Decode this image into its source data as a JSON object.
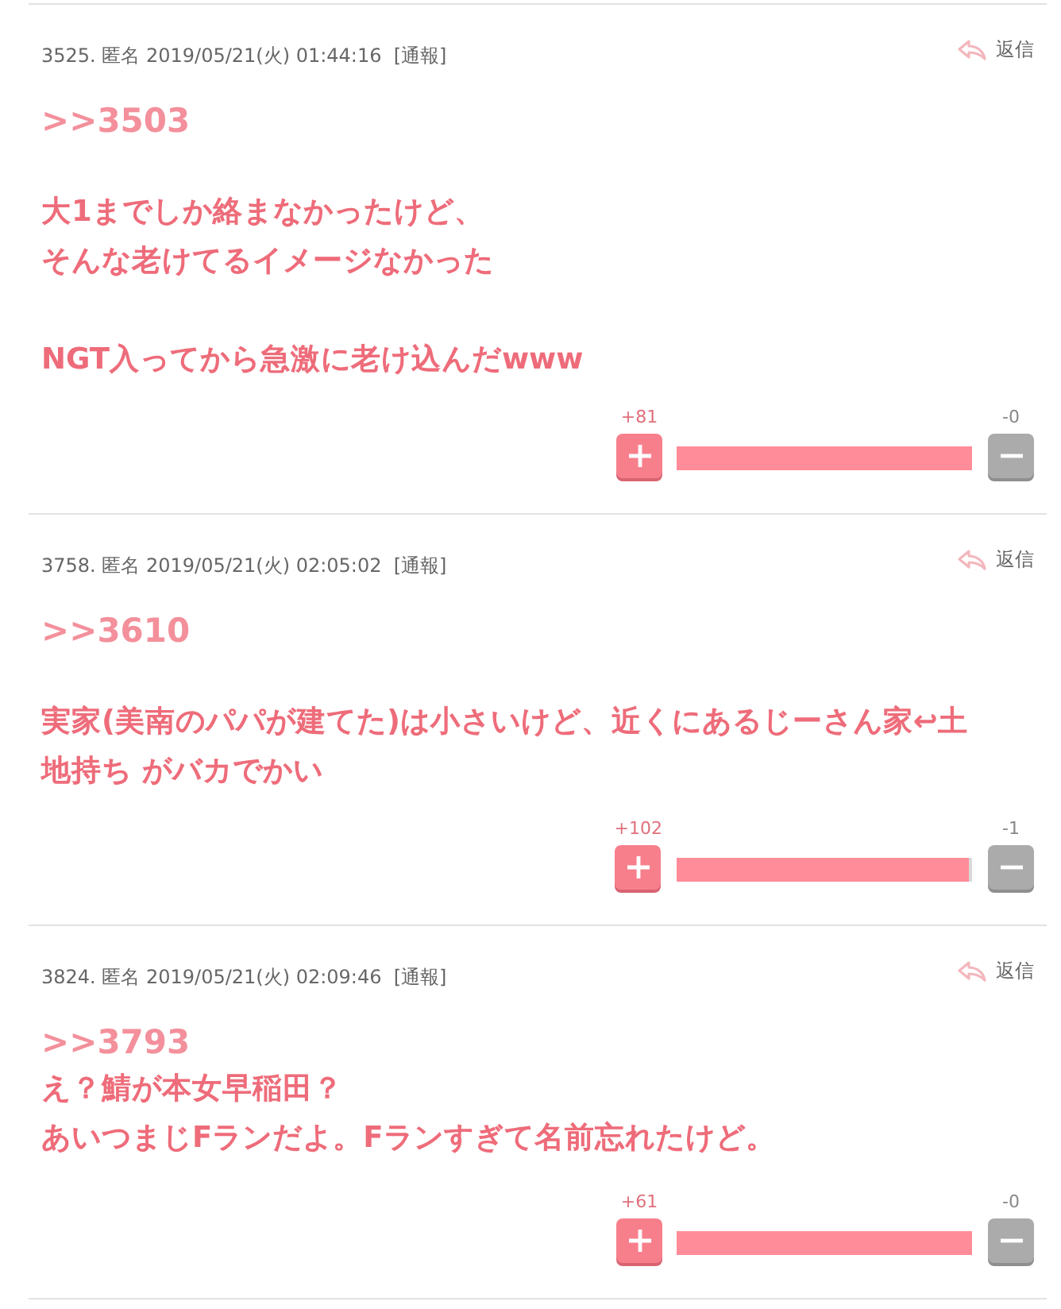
{
  "comments": [
    {
      "meta": "3525. 匿名 2019/05/21(火) 01:44:16",
      "report": "[通報]",
      "reply": "返信",
      "anchor": ">>3503",
      "compact": false,
      "paragraphs": [
        [
          "大1までしか絡まなかったけど、",
          "そんな老けてるイメージなかった"
        ],
        [
          "NGT入ってから急激に老け込んだwww"
        ]
      ],
      "plus_count": "+81",
      "minus_count": "-0",
      "level": 1
    },
    {
      "meta": "3758. 匿名 2019/05/21(火) 02:05:02",
      "report": "[通報]",
      "reply": "返信",
      "anchor": ">>3610",
      "compact": false,
      "paragraphs": [
        [
          "実家(美南のパパが建てた)は小さいけど、近くにあるじーさん家↩土",
          "地持ち がバカでかい"
        ]
      ],
      "plus_count": "+102",
      "minus_count": "-1",
      "level": 0.99
    },
    {
      "meta": "3824. 匿名 2019/05/21(火) 02:09:46",
      "report": "[通報]",
      "reply": "返信",
      "anchor": ">>3793",
      "compact": true,
      "paragraphs": [
        [
          "え？鯖が本女早稲田？",
          "あいつまじFランだよ。Fランすぎて名前忘れたけど。"
        ]
      ],
      "plus_count": "+61",
      "minus_count": "-0",
      "level": 1
    }
  ]
}
